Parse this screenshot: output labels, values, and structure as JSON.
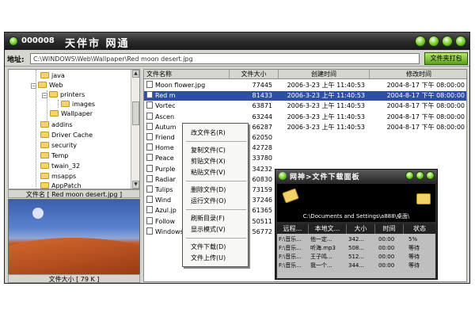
{
  "window": {
    "app_id": "000008",
    "app_title": "天伴市 网通"
  },
  "address_bar": {
    "label": "地址:",
    "value": "C:\\WINDOWS\\Web\\Wallpaper\\Red moon desert.jpg",
    "open_button": "文件夹打包"
  },
  "tree": {
    "items": [
      {
        "label": "java"
      },
      {
        "label": "Web"
      },
      {
        "label": "printers"
      },
      {
        "label": "images"
      },
      {
        "label": "Wallpaper"
      },
      {
        "label": "addins"
      },
      {
        "label": "Driver Cache"
      },
      {
        "label": "security"
      },
      {
        "label": "Temp"
      },
      {
        "label": "twain_32"
      },
      {
        "label": "msapps"
      },
      {
        "label": "AppPatch"
      }
    ]
  },
  "preview": {
    "file_name_caption": "文件名 [ Red moon desert.jpg ]",
    "file_size_caption": "文件大小 [ 79 K ]"
  },
  "file_list": {
    "columns": [
      "文件名称",
      "文件大小",
      "创建时间",
      "修改时间"
    ],
    "rows": [
      {
        "name": "Moon flower.jpg",
        "size": "77445",
        "created": "2006-3-23 上午 11:40:53",
        "modified": "2004-8-17 下午 08:00:00"
      },
      {
        "name": "Red m",
        "size": "81433",
        "created": "2006-3-23 上午 11:40:53",
        "modified": "2004-8-17 下午 08:00:00"
      },
      {
        "name": "Vortec",
        "size": "63871",
        "created": "2006-3-23 上午 11:40:53",
        "modified": "2004-8-17 下午 08:00:00"
      },
      {
        "name": "Ascen",
        "size": "63244",
        "created": "2006-3-23 上午 11:40:53",
        "modified": "2004-8-17 下午 08:00:00"
      },
      {
        "name": "Autum",
        "size": "66287",
        "created": "2006-3-23 上午 11:40:53",
        "modified": "2004-8-17 下午 08:00:00"
      },
      {
        "name": "Friend",
        "size": "62050",
        "created": "",
        "modified": ""
      },
      {
        "name": "Home",
        "size": "42728",
        "created": "",
        "modified": ""
      },
      {
        "name": "Peace",
        "size": "33780",
        "created": "",
        "modified": ""
      },
      {
        "name": "Purple",
        "size": "34232",
        "created": "",
        "modified": ""
      },
      {
        "name": "Radiar",
        "size": "60830",
        "created": "",
        "modified": ""
      },
      {
        "name": "Tulips",
        "size": "73159",
        "created": "",
        "modified": ""
      },
      {
        "name": "Wind",
        "size": "37246",
        "created": "",
        "modified": ""
      },
      {
        "name": "Azul.jp",
        "size": "61365",
        "created": "",
        "modified": ""
      },
      {
        "name": "Follow",
        "size": "50511",
        "created": "",
        "modified": ""
      },
      {
        "name": "Windows XP.jpg",
        "size": "56772",
        "created": "",
        "modified": ""
      }
    ]
  },
  "context_menu": {
    "items": [
      "改文件名(R)",
      "复制文件(C)",
      "剪贴文件(X)",
      "粘贴文件(V)",
      "删除文件(D)",
      "运行文件(O)",
      "刷新目录(F)",
      "显示模式(V)",
      "文件下载(D)",
      "文件上传(U)"
    ]
  },
  "download_window": {
    "title": "网神>文件下载面板",
    "path": "C:\\Documents and Settings\\a888\\桌面\\",
    "columns": [
      "远程...",
      "本地文...",
      "大小",
      "时间",
      "状态"
    ],
    "rows": [
      {
        "remote": "F:\\音乐...",
        "local": "他一定...",
        "size": "342...",
        "time": "00:00",
        "status": "5%"
      },
      {
        "remote": "F:\\音乐...",
        "local": "听海.mp3",
        "size": "508...",
        "time": "00:00",
        "status": "等待"
      },
      {
        "remote": "F:\\音乐...",
        "local": "王子鸣...",
        "size": "512...",
        "time": "00:00",
        "status": "等待"
      },
      {
        "remote": "F:\\音乐...",
        "local": "我一个...",
        "size": "344...",
        "time": "00:00",
        "status": "等待"
      }
    ]
  }
}
